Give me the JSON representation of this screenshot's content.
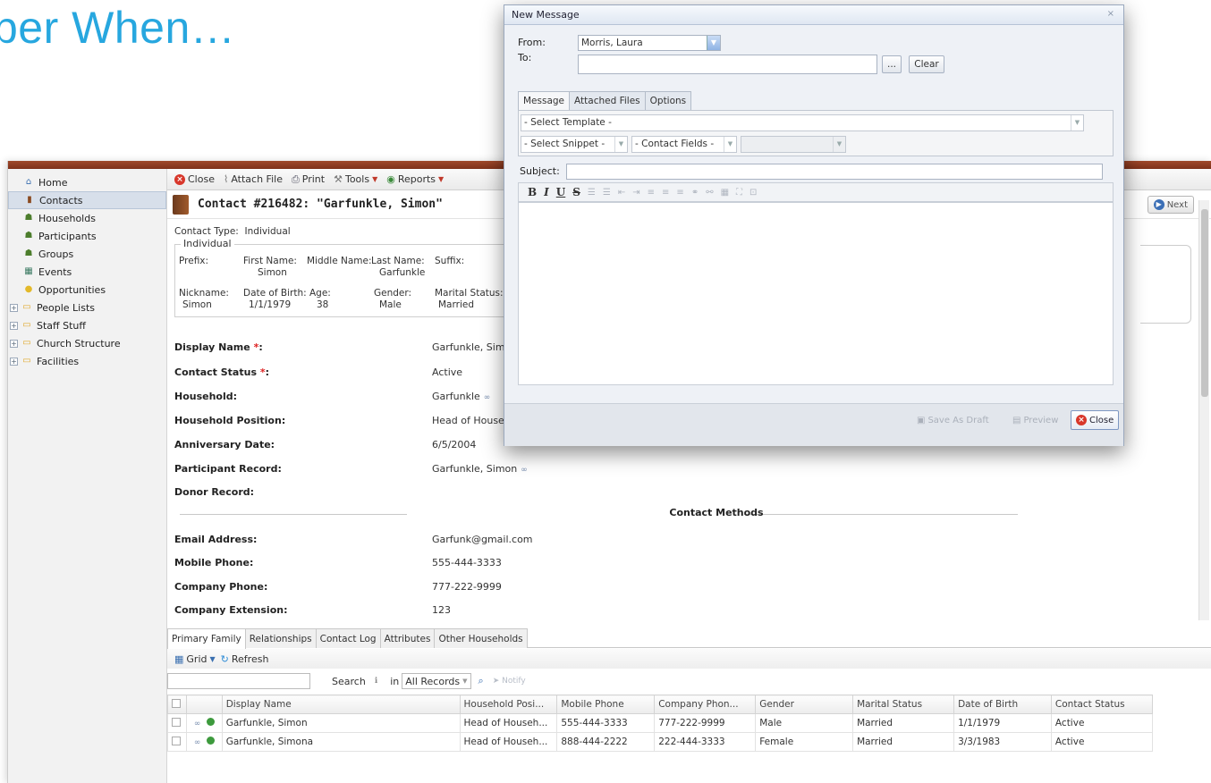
{
  "heading": "ber When…",
  "sidebar": {
    "items": [
      {
        "label": "Home",
        "icon": "home-icon"
      },
      {
        "label": "Contacts",
        "icon": "book-icon"
      },
      {
        "label": "Households",
        "icon": "people-icon"
      },
      {
        "label": "Participants",
        "icon": "people-icon"
      },
      {
        "label": "Groups",
        "icon": "group-icon"
      },
      {
        "label": "Events",
        "icon": "calendar-icon"
      },
      {
        "label": "Opportunities",
        "icon": "bulb-icon"
      },
      {
        "label": "People Lists",
        "icon": "folder-icon"
      },
      {
        "label": "Staff Stuff",
        "icon": "folder-icon"
      },
      {
        "label": "Church Structure",
        "icon": "folder-icon"
      },
      {
        "label": "Facilities",
        "icon": "folder-icon"
      }
    ]
  },
  "toolbar": {
    "close": "Close",
    "attach": "Attach File",
    "print": "Print",
    "tools": "Tools",
    "reports": "Reports"
  },
  "contact": {
    "title": "Contact #216482: \"Garfunkle, Simon\"",
    "next": "Next",
    "type_label": "Contact Type:",
    "type_value": "Individual",
    "legend": "Individual",
    "prefix_label": "Prefix:",
    "first_label": "First Name:",
    "first_value": "Simon",
    "middle_label": "Middle Name:",
    "last_label": "Last Name:",
    "last_value": "Garfunkle",
    "suffix_label": "Suffix:",
    "nick_label": "Nickname:",
    "nick_value": "Simon",
    "dob_label": "Date of Birth:",
    "dob_value": "1/1/1979",
    "age_label": "Age:",
    "age_value": "38",
    "gender_label": "Gender:",
    "gender_value": "Male",
    "marital_label": "Marital Status:",
    "marital_value": "Married"
  },
  "fields": [
    {
      "label": "Display Name",
      "required": "*",
      "colon": ":",
      "value": "Garfunkle, Sim",
      "link": ""
    },
    {
      "label": "Contact Status",
      "required": "*",
      "colon": ":",
      "value": "Active",
      "link": ""
    },
    {
      "label": "Household:",
      "required": "",
      "colon": "",
      "value": "Garfunkle",
      "link": "link"
    },
    {
      "label": "Household Position:",
      "required": "",
      "colon": "",
      "value": "Head of Housel",
      "link": ""
    },
    {
      "label": "Anniversary Date:",
      "required": "",
      "colon": "",
      "value": "6/5/2004",
      "link": ""
    },
    {
      "label": "Participant Record:",
      "required": "",
      "colon": "",
      "value": "Garfunkle, Simon",
      "link": "link"
    },
    {
      "label": "Donor Record:",
      "required": "",
      "colon": "",
      "value": "",
      "link": ""
    }
  ],
  "contact_methods_title": "Contact Methods",
  "contact_methods": [
    {
      "label": "Email Address:",
      "value": "Garfunk@gmail.com"
    },
    {
      "label": "Mobile Phone:",
      "value": "555-444-3333"
    },
    {
      "label": "Company Phone:",
      "value": "777-222-9999"
    },
    {
      "label": "Company Extension:",
      "value": "123"
    }
  ],
  "bottom_tabs": [
    "Primary Family",
    "Relationships",
    "Contact Log",
    "Attributes",
    "Other Households"
  ],
  "grid_toolbar": {
    "grid": "Grid",
    "refresh": "Refresh"
  },
  "search": {
    "label": "Search",
    "in_label": "in",
    "scope": "All Records",
    "notify": "Notify"
  },
  "grid": {
    "headers": [
      "Display Name",
      "Household Posi...",
      "Mobile Phone",
      "Company Phon...",
      "Gender",
      "Marital Status",
      "Date of Birth",
      "Contact Status"
    ],
    "rows": [
      [
        "Garfunkle, Simon",
        "Head of Househ...",
        "555-444-3333",
        "777-222-9999",
        "Male",
        "Married",
        "1/1/1979",
        "Active"
      ],
      [
        "Garfunkle, Simona",
        "Head of Househ...",
        "888-444-2222",
        "222-444-3333",
        "Female",
        "Married",
        "3/3/1983",
        "Active"
      ]
    ]
  },
  "dialog": {
    "title": "New Message",
    "from_label": "From:",
    "from_value": "Morris, Laura",
    "to_label": "To:",
    "to_value": "",
    "browse": "...",
    "clear": "Clear",
    "tabs": [
      "Message",
      "Attached Files",
      "Options"
    ],
    "template": "- Select Template -",
    "snippet": "- Select Snippet -",
    "contact_fields": "- Contact Fields -",
    "subject_label": "Subject:",
    "subject_value": "",
    "save_draft": "Save As Draft",
    "preview": "Preview",
    "close": "Close"
  }
}
